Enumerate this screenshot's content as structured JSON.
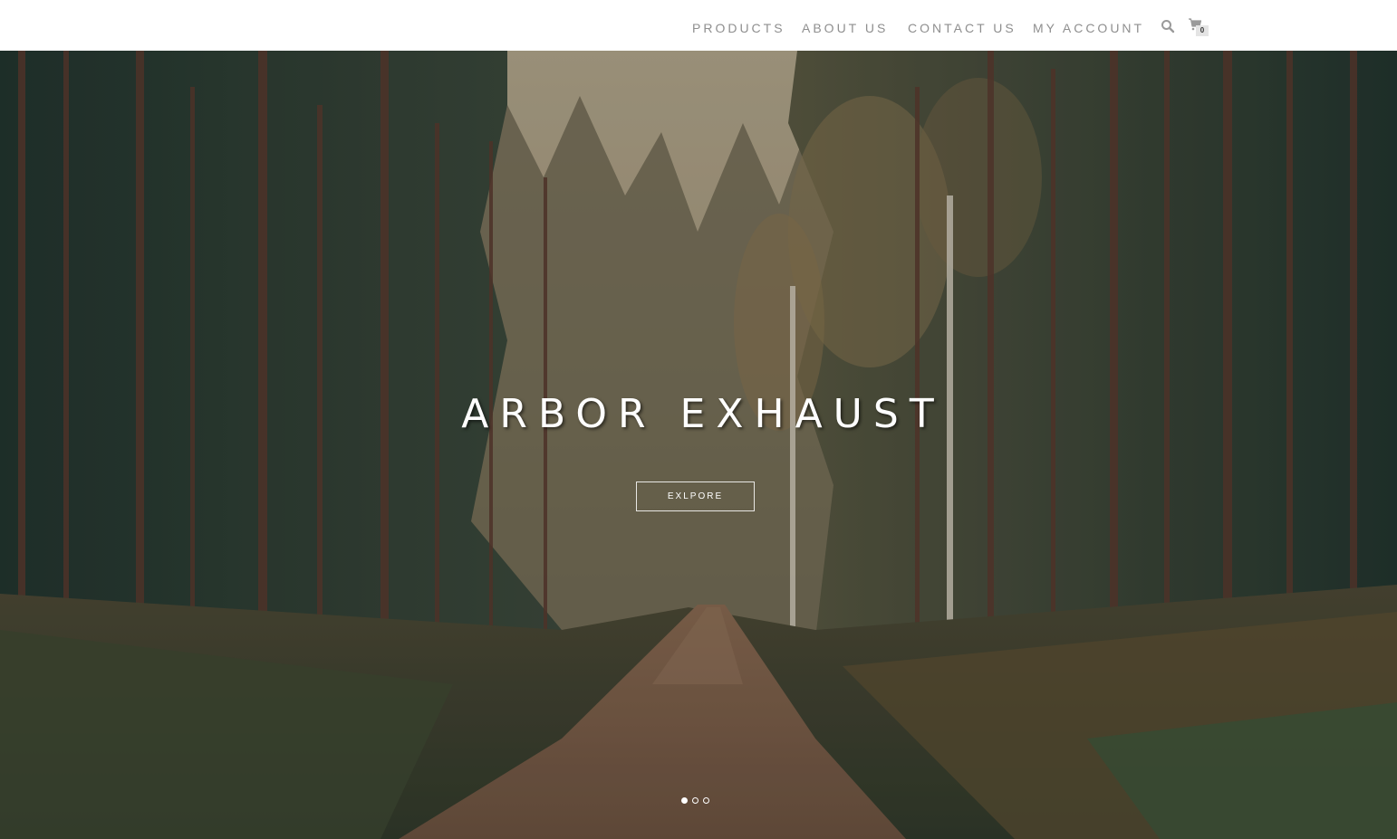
{
  "nav": {
    "items": [
      {
        "label": "PRODUCTS"
      },
      {
        "label": "ABOUT US"
      },
      {
        "label": "CONTACT US"
      },
      {
        "label": "MY ACCOUNT"
      }
    ],
    "search_icon": "search-icon",
    "cart_icon": "cart-icon",
    "cart_count": "0"
  },
  "hero": {
    "title": "ARBOR EXHAUST",
    "button_label": "EXLPORE",
    "slides": {
      "count": 3,
      "active": 1
    }
  },
  "colors": {
    "nav_text": "#8f8f8f",
    "header_bg": "#ffffff",
    "hero_text": "#ffffff"
  }
}
